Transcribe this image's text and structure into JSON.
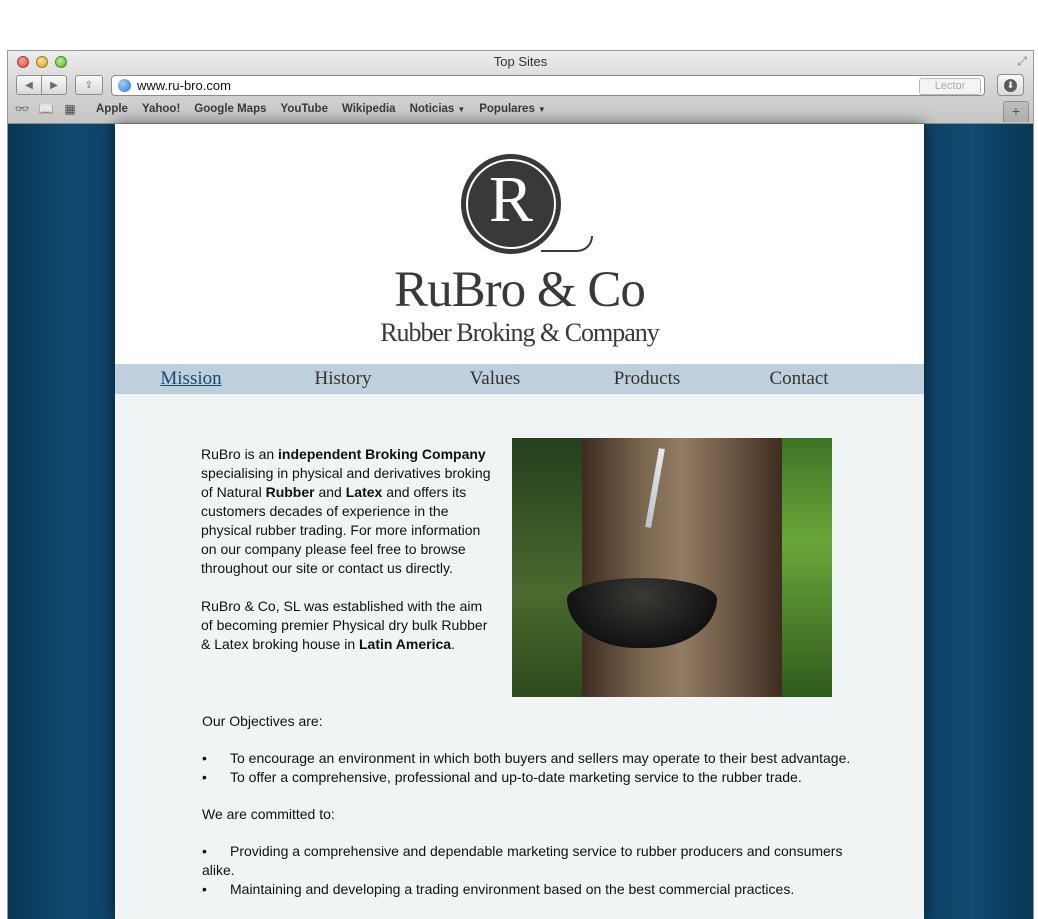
{
  "window": {
    "title": "Top Sites"
  },
  "toolbar": {
    "url": "www.ru-bro.com",
    "reader_label": "Lector"
  },
  "bookmarks": [
    {
      "label": "Apple"
    },
    {
      "label": "Yahoo!"
    },
    {
      "label": "Google Maps"
    },
    {
      "label": "YouTube"
    },
    {
      "label": "Wikipedia"
    },
    {
      "label": "Noticias",
      "menu": true
    },
    {
      "label": "Populares",
      "menu": true
    }
  ],
  "site": {
    "logo_letter": "R",
    "brand": "RuBro & Co",
    "tagline": "Rubber Broking & Company",
    "menu": [
      "Mission",
      "History",
      "Values",
      "Products",
      "Contact"
    ],
    "active_menu": "Mission",
    "intro": [
      [
        {
          "t": "RuBro is an "
        },
        {
          "t": "independent Broking Company",
          "b": true
        },
        {
          "t": " specialising in physical and derivatives broking of Natural "
        },
        {
          "t": "Rubber",
          "b": true
        },
        {
          "t": " and "
        },
        {
          "t": "Latex",
          "b": true
        },
        {
          "t": " and offers its customers decades of experience in the physical rubber trading. For more information on our company please feel free to browse throughout our site or contact us directly."
        }
      ],
      [
        {
          "t": "RuBro & Co, SL was established with the aim of becoming premier Physical dry bulk Rubber & Latex broking house in "
        },
        {
          "t": "Latin America",
          "b": true
        },
        {
          "t": "."
        }
      ]
    ],
    "objectives_heading": "Our Objectives are:",
    "objectives": [
      "To encourage an environment in which both buyers and sellers may operate to their best advantage.",
      "To offer a comprehensive, professional and up-to-date marketing service to the rubber trade."
    ],
    "committed_heading": "We are committed to:",
    "commitments": [
      "Providing a comprehensive and dependable marketing service to rubber producers and consumers alike.",
      "Maintaining and developing a trading environment based on the best commercial practices."
    ],
    "bullet": "•"
  }
}
